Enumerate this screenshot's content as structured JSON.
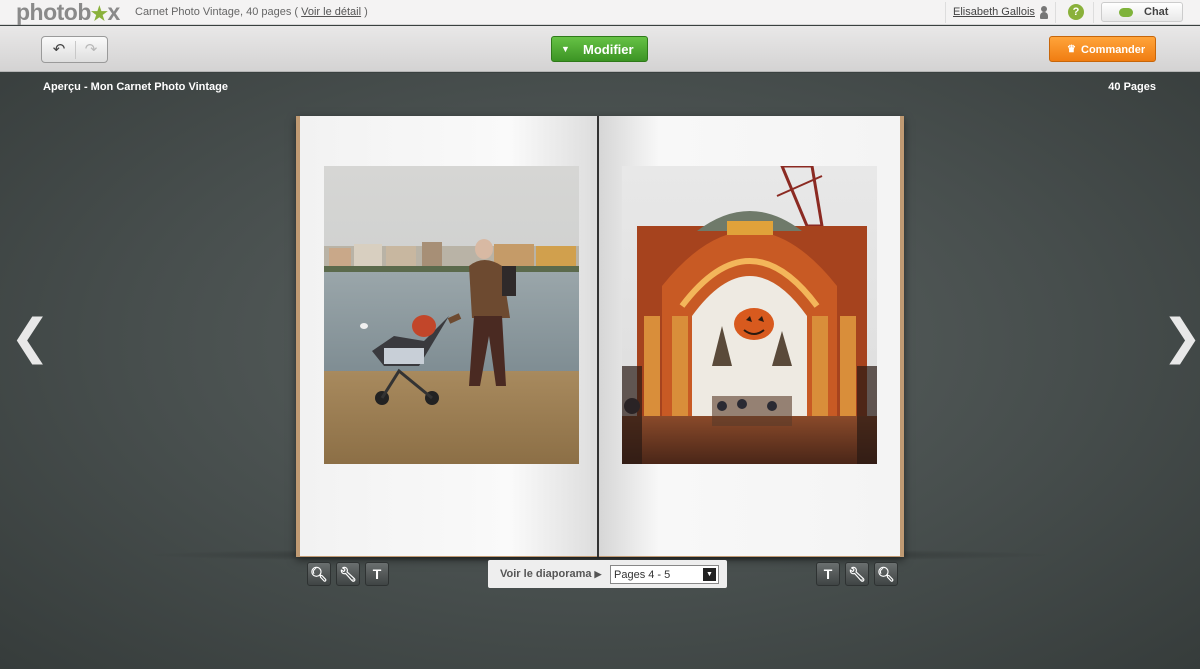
{
  "topbar": {
    "logo_prefix": "photob",
    "logo_suffix": "x",
    "doc_title": "Carnet Photo Vintage, 40 pages",
    "doc_detail_link": "Voir le détail",
    "user_name": "Elisabeth Gallois",
    "help_label": "?",
    "chat_label": "Chat"
  },
  "toolbar": {
    "undo_icon": "↶",
    "redo_icon": "↷",
    "modifier_label": "Modifier",
    "commander_label": "Commander"
  },
  "stage": {
    "preview_label": "Aperçu   - Mon Carnet Photo Vintage",
    "page_count": "40 Pages",
    "prev_arrow": "❮",
    "next_arrow": "❯"
  },
  "controls": {
    "left_tools": [
      {
        "name": "zoom-icon",
        "glyph": "🔍︎"
      },
      {
        "name": "wrench-icon",
        "glyph": "🔧︎"
      },
      {
        "name": "text-icon",
        "glyph": "T"
      }
    ],
    "right_tools": [
      {
        "name": "text-icon",
        "glyph": "T"
      },
      {
        "name": "wrench-icon",
        "glyph": "🔧︎"
      },
      {
        "name": "zoom-icon",
        "glyph": "🔍︎"
      }
    ],
    "slideshow_label": "Voir le diaporama",
    "pages_select_value": "Pages 4 - 5"
  },
  "colors": {
    "brand_green": "#8ab13b",
    "modifier_green": "#4aa82d",
    "commander_orange": "#f58c1f",
    "stage_bg": "#474e4d"
  }
}
